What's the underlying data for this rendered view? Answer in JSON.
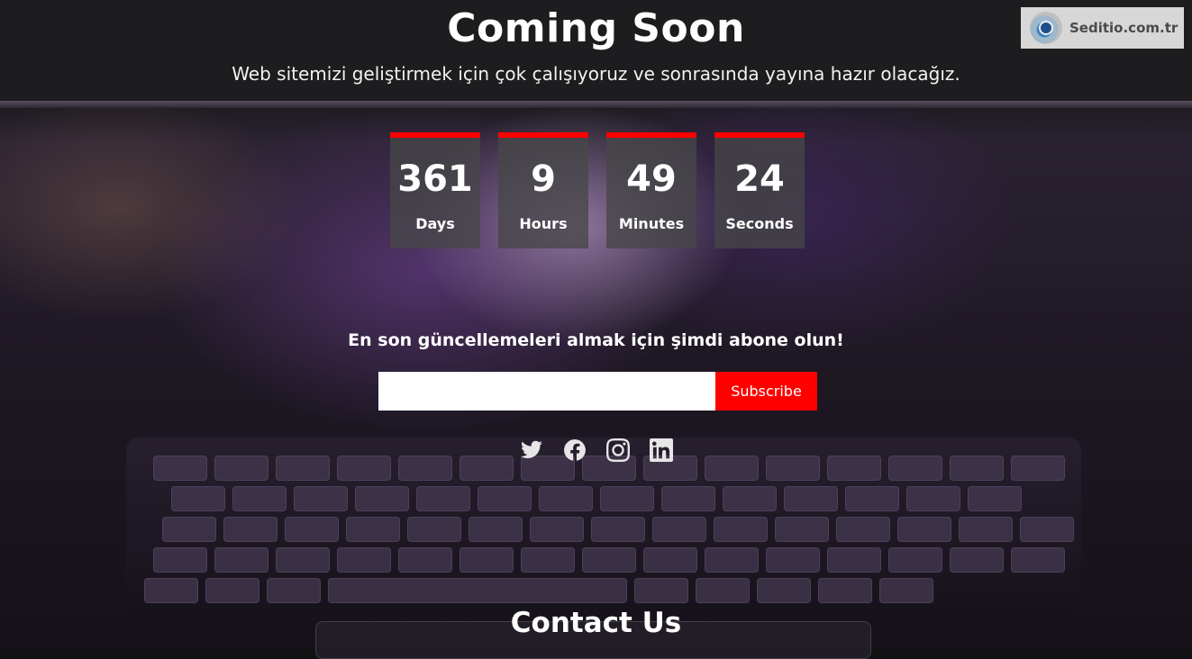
{
  "header": {
    "title": "Coming Soon",
    "subtitle": "Web sitemizi geliştirmek için çok çalışıyoruz ve sonrasında yayına hazır olacağız."
  },
  "brand": {
    "name": "Seditio.com.tr",
    "logo_icon": "seditio-logo-icon"
  },
  "countdown": [
    {
      "value": "361",
      "label": "Days"
    },
    {
      "value": "9",
      "label": "Hours"
    },
    {
      "value": "49",
      "label": "Minutes"
    },
    {
      "value": "24",
      "label": "Seconds"
    }
  ],
  "subscribe": {
    "heading": "En son güncellemeleri almak için şimdi abone olun!",
    "email_value": "",
    "button_label": "Subscribe"
  },
  "socials": [
    {
      "name": "twitter-icon"
    },
    {
      "name": "facebook-icon"
    },
    {
      "name": "instagram-icon"
    },
    {
      "name": "linkedin-icon"
    }
  ],
  "contact": {
    "heading": "Contact Us"
  },
  "colors": {
    "accent": "#ff0000",
    "top_band": "#1d1c1e",
    "countdown_box": "#464648",
    "brand_bg": "#d7d7d7"
  }
}
